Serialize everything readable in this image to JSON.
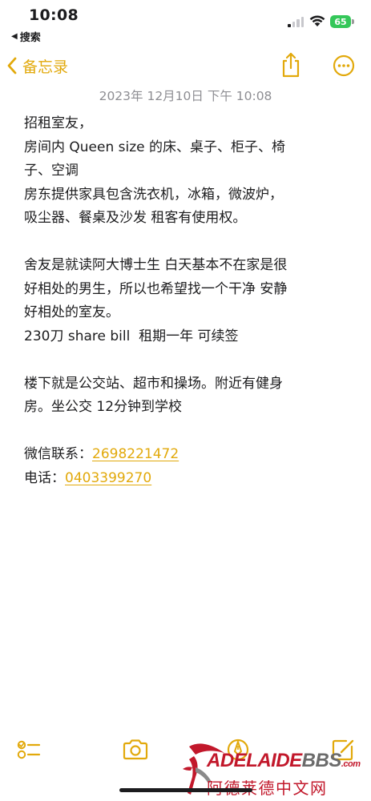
{
  "status_bar": {
    "time": "10:08",
    "back_app_label": "搜索",
    "battery_level": "65"
  },
  "nav": {
    "back_label": "备忘录",
    "back_icon": "chevron-left-icon",
    "share_icon": "share-icon",
    "more_icon": "ellipsis-circle-icon",
    "accent_color": "#e2a90b"
  },
  "note": {
    "date": "2023年 12月10日 下午 10:08",
    "lines": [
      "招租室友，",
      "房间内 Queen size 的床、桌子、柜子、椅",
      "子、空调",
      "房东提供家具包含洗衣机，冰箱，微波炉，",
      "吸尘器、餐桌及沙发 租客有使用权。",
      "",
      "舍友是就读阿大博士生 白天基本不在家是很",
      "好相处的男生，所以也希望找一个干净 安静",
      "好相处的室友。",
      "230刀 share bill  租期一年 可续签",
      "",
      "楼下就是公交站、超市和操场。附近有健身",
      "房。坐公交 12分钟到学校",
      ""
    ],
    "wechat_label": "微信联系：",
    "wechat_value": "2698221472",
    "phone_label": "电话：",
    "phone_value": "0403399270"
  },
  "toolbar": {
    "checklist_icon": "checklist-icon",
    "camera_icon": "camera-icon",
    "markup_icon": "markup-pen-icon",
    "compose_icon": "compose-icon"
  },
  "watermark": {
    "brand_main": "ADELAIDE",
    "brand_suffix": "BBS",
    "brand_domain": ".com",
    "brand_cn": "阿德莱德中文网"
  }
}
